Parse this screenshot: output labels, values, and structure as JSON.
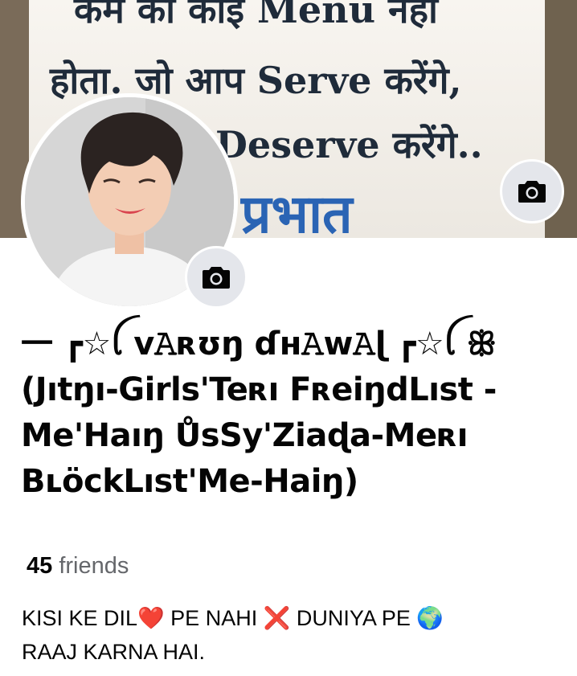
{
  "cover": {
    "line1": "कम का काइ Menu नहा",
    "line2": "होता. जो आप Serve करेंगे,",
    "line3": "Deserve करेंगे..",
    "line4": "प्रभात"
  },
  "icons": {
    "cover_camera": "camera-icon",
    "avatar_camera": "camera-icon"
  },
  "profile": {
    "name": "一 ┏☆ꪶ v𝙰ʀʊŋ ɗʜ𝙰ᴡ𝙰ɭ ┏☆ꪶ ꕥ (Jıtŋı-Girls'Teʀı FʀeiŋdLıst -Me'Haıŋ ŮsSy'Ziaɖa-Meʀı BʟöckLıst'Me-Haiŋ)",
    "friends_count": "45",
    "friends_label": "friends",
    "bio_line1": "KISI KE DIL❤️ PE NAHI ❌ DUNIYA PE 🌍",
    "bio_line2": "RAAJ KARNA HAI."
  },
  "colors": {
    "background": "#ffffff",
    "text_primary": "#050505",
    "text_secondary": "#65676b",
    "camera_button_bg": "#e4e6eb"
  }
}
